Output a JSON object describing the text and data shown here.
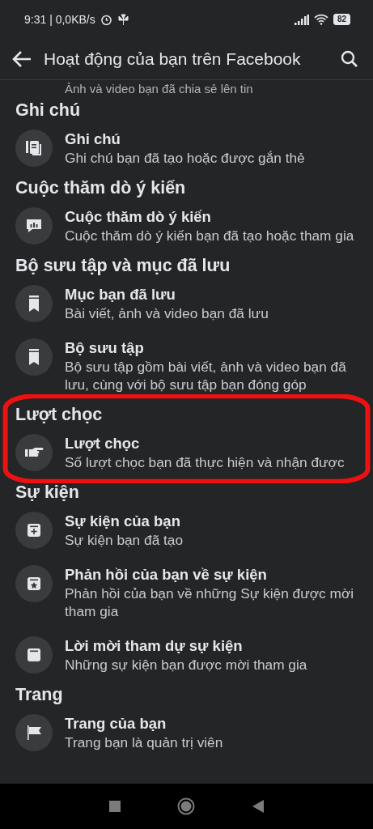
{
  "status_bar": {
    "time": "9:31 | 0,0KB/s",
    "battery": "82"
  },
  "header": {
    "title": "Hoạt động của bạn trên Facebook"
  },
  "partial_row": {
    "description": "Ảnh và video bạn đã chia sẻ lên tin"
  },
  "sections": [
    {
      "heading": "Ghi chú",
      "circled": false,
      "items": [
        {
          "kind": "notes",
          "title": "Ghi chú",
          "description": "Ghi chú bạn đã tạo hoặc được gắn thẻ"
        }
      ]
    },
    {
      "heading": "Cuộc thăm dò ý kiến",
      "circled": false,
      "items": [
        {
          "kind": "poll",
          "title": "Cuộc thăm dò ý kiến",
          "description": "Cuộc thăm dò ý kiến bạn đã tạo hoặc tham gia"
        }
      ]
    },
    {
      "heading": "Bộ sưu tập và mục đã lưu",
      "circled": false,
      "items": [
        {
          "kind": "bookmark",
          "title": "Mục bạn đã lưu",
          "description": "Bài viết, ảnh và video bạn đã lưu"
        },
        {
          "kind": "bookmark",
          "title": "Bộ sưu tập",
          "description": "Bộ sưu tập gồm bài viết, ảnh và video bạn đã lưu, cùng với bộ sưu tập bạn đóng góp"
        }
      ]
    },
    {
      "heading": "Lượt chọc",
      "circled": true,
      "items": [
        {
          "kind": "poke",
          "title": "Lượt chọc",
          "description": "Số lượt chọc bạn đã thực hiện và nhận được"
        }
      ]
    },
    {
      "heading": "Sự kiện",
      "circled": false,
      "items": [
        {
          "kind": "event-add",
          "title": "Sự kiện của bạn",
          "description": "Sự kiện bạn đã tạo"
        },
        {
          "kind": "event-star",
          "title": "Phản hồi của bạn về sự kiện",
          "description": "Phản hồi của bạn về những Sự kiện được mời tham gia"
        },
        {
          "kind": "event",
          "title": "Lời mời tham dự sự kiện",
          "description": "Những sự kiện bạn được mời tham gia"
        }
      ]
    },
    {
      "heading": "Trang",
      "circled": false,
      "items": [
        {
          "kind": "flag",
          "title": "Trang của bạn",
          "description": "Trang bạn là quản trị viên"
        }
      ]
    }
  ]
}
